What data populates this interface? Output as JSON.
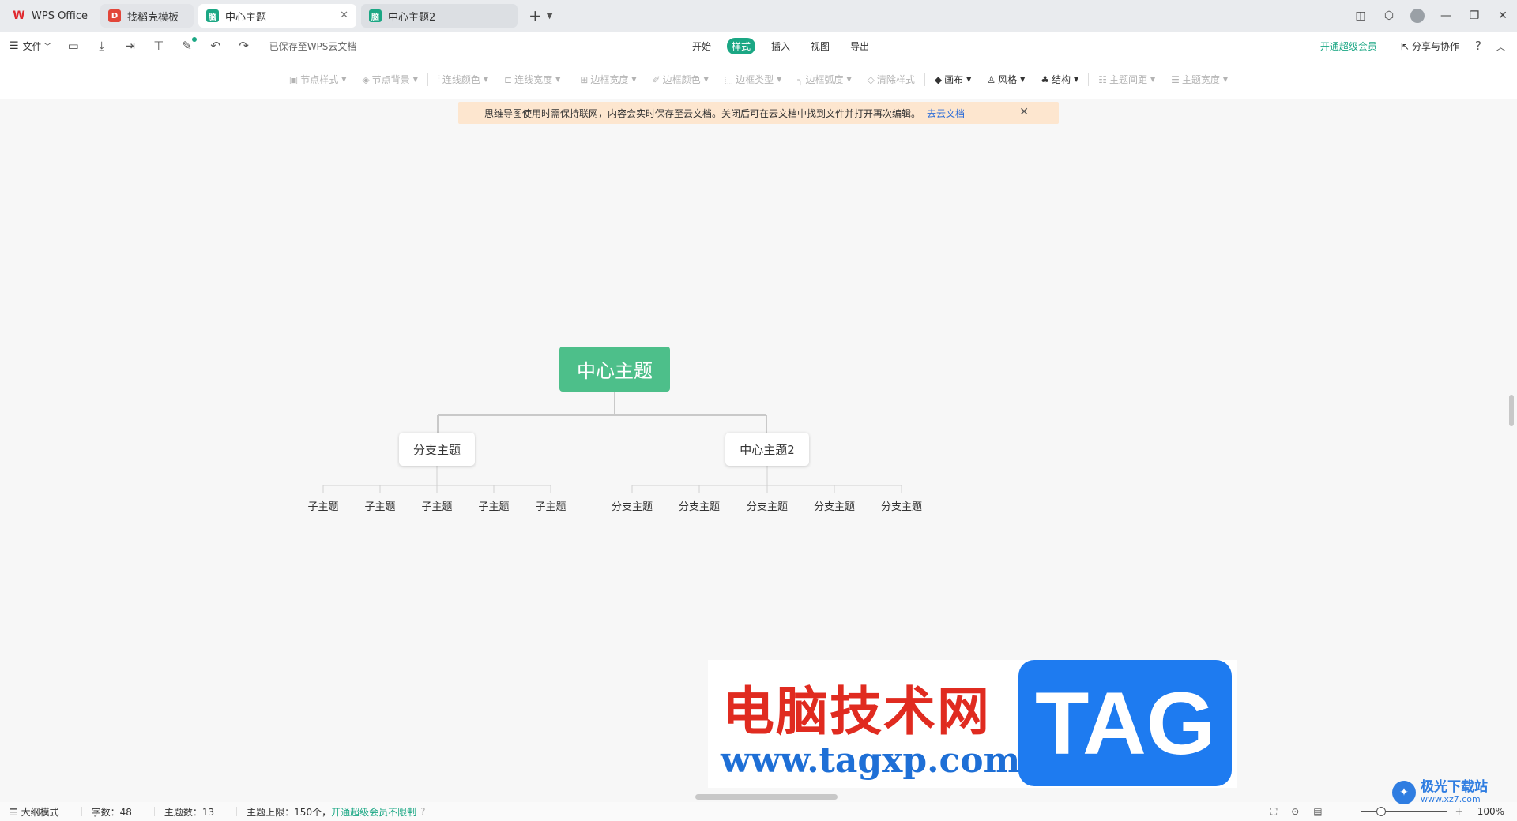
{
  "tabs": [
    {
      "label": "WPS Office",
      "icon": "wps-logo-icon"
    },
    {
      "label": "找稻壳模板",
      "icon": "daoke-icon"
    },
    {
      "label": "中心主题",
      "icon": "mindmap-icon",
      "active": true
    },
    {
      "label": "中心主题2",
      "icon": "mindmap-icon"
    }
  ],
  "menubar": {
    "file_label": "文件",
    "saved_text": "已保存至WPS云文档",
    "tabs": [
      "开始",
      "样式",
      "插入",
      "视图",
      "导出"
    ],
    "active_tab": "样式",
    "vip_label": "开通超级会员",
    "share_label": "分享与协作"
  },
  "toolbar": {
    "items": [
      "节点样式",
      "节点背景",
      "连线颜色",
      "连线宽度",
      "边框宽度",
      "边框颜色",
      "边框类型",
      "边框弧度",
      "清除样式",
      "画布",
      "风格",
      "结构",
      "主题间距",
      "主题宽度"
    ]
  },
  "notice": {
    "text": "思维导图使用时需保持联网，内容会实时保存至云文档。关闭后可在云文档中找到文件并打开再次编辑。",
    "link": "去云文档"
  },
  "mindmap": {
    "root": "中心主题",
    "branch1": "分支主题",
    "branch2": "中心主题2",
    "branch1_children": [
      "子主题",
      "子主题",
      "子主题",
      "子主题",
      "子主题"
    ],
    "branch2_children": [
      "分支主题",
      "分支主题",
      "分支主题",
      "分支主题",
      "分支主题"
    ]
  },
  "status": {
    "outline_mode": "大纲模式",
    "word_count": "字数：48",
    "topic_count": "主题数：13",
    "topic_limit": "主题上限：150个，",
    "vip_unlimited": "开通超级会员不限制",
    "zoom": "100%"
  },
  "watermark": {
    "cn_text": "电脑技术网",
    "url": "www.tagxp.com",
    "tag": "TAG",
    "corner_title": "极光下载站",
    "corner_url": "www.xz7.com"
  },
  "colors": {
    "accent": "#1ba784",
    "root_node": "#4dbf8a",
    "notice_bg": "#fde6cf",
    "link": "#2b6cd8"
  }
}
